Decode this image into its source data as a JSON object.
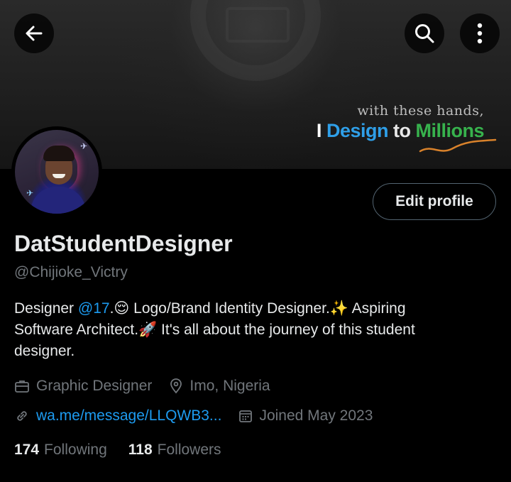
{
  "banner": {
    "tagline_small": "with these hands,",
    "tagline_parts": [
      "I",
      "Design",
      "to",
      "Millions"
    ]
  },
  "header_icons": [
    "back-arrow-icon",
    "search-icon",
    "more-vertical-icon"
  ],
  "edit_profile_label": "Edit profile",
  "profile": {
    "display_name": "DatStudentDesigner",
    "handle": "@Chijioke_Victry",
    "bio": {
      "pre": "Designer ",
      "mention": "@17",
      "line1_rest": ".😌 Logo/Brand Identity Designer.✨ Aspiring",
      "line2": "Software Architect.🚀  It's all about the journey of this student",
      "line3": "designer."
    },
    "profession": "Graphic Designer",
    "location": "Imo, Nigeria",
    "website": "wa.me/message/LLQWB3...",
    "joined": "Joined May 2023"
  },
  "stats": {
    "following_count": "174",
    "following_label": "Following",
    "followers_count": "118",
    "followers_label": "Followers"
  },
  "colors": {
    "accent_blue": "#1d9bf0",
    "muted": "#71767b",
    "text": "#e7e9ea",
    "background": "#000000"
  }
}
